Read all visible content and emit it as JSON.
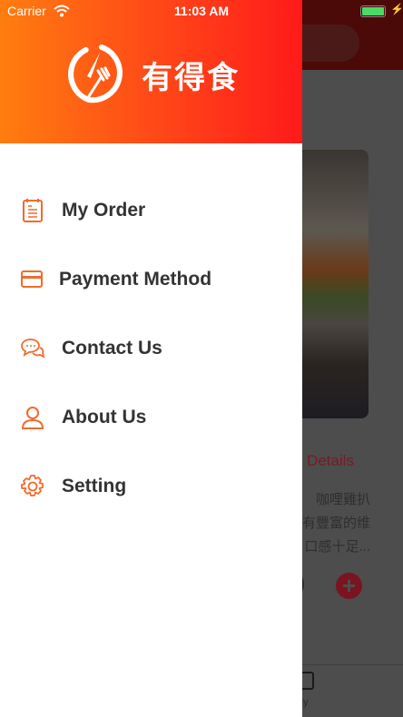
{
  "status_bar": {
    "carrier": "Carrier",
    "time": "11:03 AM",
    "battery_level": 1.0,
    "charging": true
  },
  "drawer": {
    "brand": "有得食",
    "accent_color": "#f26b2c",
    "items": [
      {
        "label": "My Order",
        "icon": "clipboard-icon"
      },
      {
        "label": "Payment Method",
        "icon": "credit-card-icon"
      },
      {
        "label": "Contact Us",
        "icon": "chat-bubbles-icon"
      },
      {
        "label": "About Us",
        "icon": "user-icon"
      },
      {
        "label": "Setting",
        "icon": "gear-icon"
      }
    ]
  },
  "background": {
    "details_label": "Details",
    "description_lines": [
      "咖哩雞扒",
      "有豐富的维",
      "口感十足..."
    ],
    "price_fragment": "0",
    "tab_label_fragment": "ekly"
  }
}
